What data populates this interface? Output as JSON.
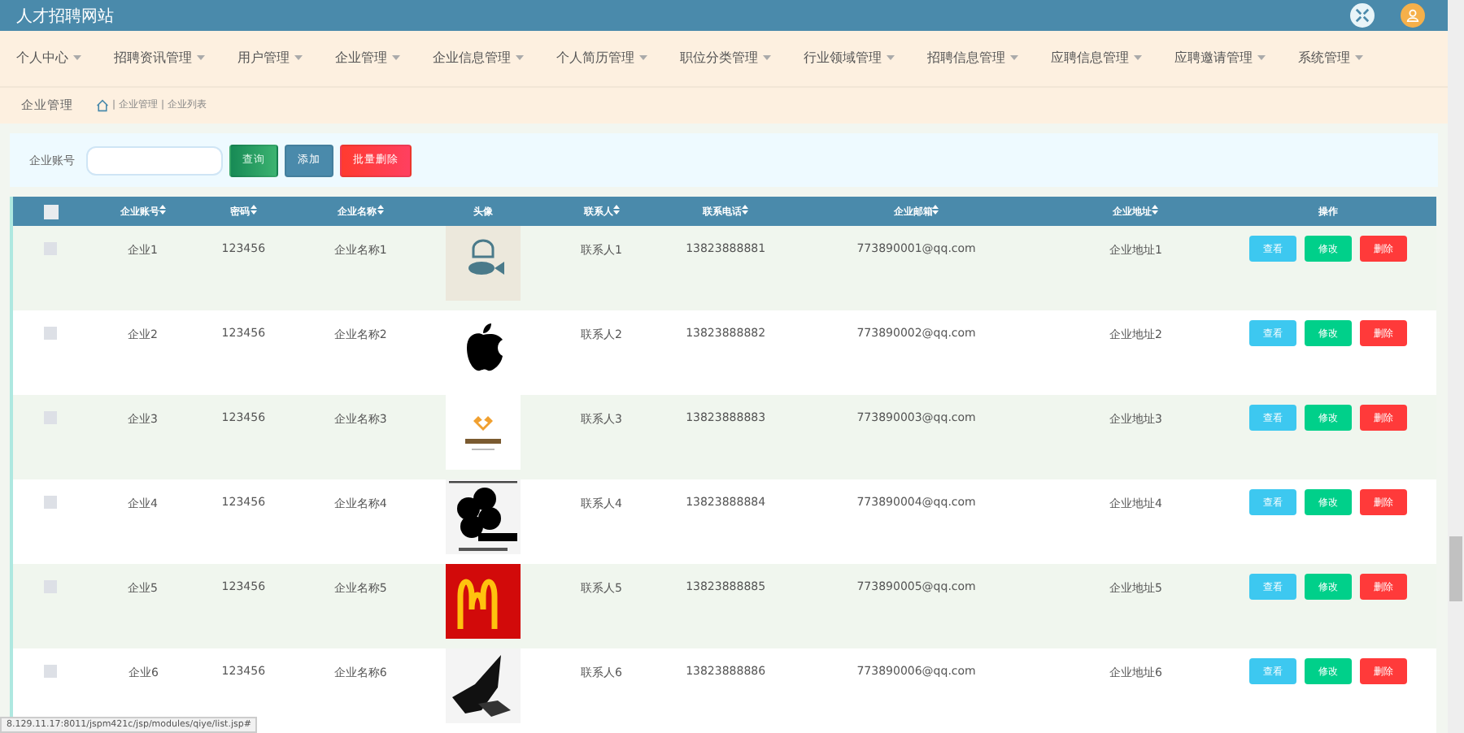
{
  "header": {
    "title": "人才招聘网站"
  },
  "nav": [
    {
      "label": "个人中心"
    },
    {
      "label": "招聘资讯管理"
    },
    {
      "label": "用户管理"
    },
    {
      "label": "企业管理"
    },
    {
      "label": "企业信息管理"
    },
    {
      "label": "个人简历管理"
    },
    {
      "label": "职位分类管理"
    },
    {
      "label": "行业领域管理"
    },
    {
      "label": "招聘信息管理"
    },
    {
      "label": "应聘信息管理"
    },
    {
      "label": "应聘邀请管理"
    },
    {
      "label": "系统管理"
    }
  ],
  "breadcrumb": {
    "title": "企业管理",
    "path": [
      {
        "separator": "|",
        "label": "企业管理"
      },
      {
        "separator": "|",
        "label": "企业列表"
      }
    ]
  },
  "search": {
    "label": "企业账号",
    "buttons": [
      {
        "label": "查询",
        "kind": "search"
      },
      {
        "label": "添加",
        "kind": "add"
      },
      {
        "label": "批量删除",
        "kind": "delete"
      }
    ]
  },
  "table": {
    "all_checked": false,
    "columns": [
      {
        "label": "企业账号",
        "sortable": true
      },
      {
        "label": "密码",
        "sortable": true
      },
      {
        "label": "企业名称",
        "sortable": true
      },
      {
        "label": "头像",
        "sortable": false
      },
      {
        "label": "联系人",
        "sortable": true
      },
      {
        "label": "联系电话",
        "sortable": true
      },
      {
        "label": "企业邮箱",
        "sortable": true
      },
      {
        "label": "企业地址",
        "sortable": true
      },
      {
        "label": "操作",
        "sortable": false
      }
    ],
    "rows": [
      {
        "checked": false,
        "account": "企业1",
        "password": "123456",
        "name": "企业名称1",
        "logo": {
          "kind": "fish"
        },
        "contact": "联系人1",
        "phone": "13823888881",
        "email": "773890001@qq.com",
        "address": "企业地址1",
        "actions": [
          {
            "label": "查看",
            "kind": "view"
          },
          {
            "label": "修改",
            "kind": "edit"
          },
          {
            "label": "删除",
            "kind": "delete"
          }
        ]
      },
      {
        "checked": false,
        "account": "企业2",
        "password": "123456",
        "name": "企业名称2",
        "logo": {
          "kind": "apple"
        },
        "contact": "联系人2",
        "phone": "13823888882",
        "email": "773890002@qq.com",
        "address": "企业地址2",
        "actions": [
          {
            "label": "查看",
            "kind": "view"
          },
          {
            "label": "修改",
            "kind": "edit"
          },
          {
            "label": "删除",
            "kind": "delete"
          }
        ]
      },
      {
        "checked": false,
        "account": "企业3",
        "password": "123456",
        "name": "企业名称3",
        "logo": {
          "kind": "heart"
        },
        "contact": "联系人3",
        "phone": "13823888883",
        "email": "773890003@qq.com",
        "address": "企业地址3",
        "actions": [
          {
            "label": "查看",
            "kind": "view"
          },
          {
            "label": "修改",
            "kind": "edit"
          },
          {
            "label": "删除",
            "kind": "delete"
          }
        ]
      },
      {
        "checked": false,
        "account": "企业4",
        "password": "123456",
        "name": "企业名称4",
        "logo": {
          "kind": "clover"
        },
        "contact": "联系人4",
        "phone": "13823888884",
        "email": "773890004@qq.com",
        "address": "企业地址4",
        "actions": [
          {
            "label": "查看",
            "kind": "view"
          },
          {
            "label": "修改",
            "kind": "edit"
          },
          {
            "label": "删除",
            "kind": "delete"
          }
        ]
      },
      {
        "checked": false,
        "account": "企业5",
        "password": "123456",
        "name": "企业名称5",
        "logo": {
          "kind": "arches"
        },
        "contact": "联系人5",
        "phone": "13823888885",
        "email": "773890005@qq.com",
        "address": "企业地址5",
        "actions": [
          {
            "label": "查看",
            "kind": "view"
          },
          {
            "label": "修改",
            "kind": "edit"
          },
          {
            "label": "删除",
            "kind": "delete"
          }
        ]
      },
      {
        "checked": false,
        "account": "企业6",
        "password": "123456",
        "name": "企业名称6",
        "logo": {
          "kind": "bird"
        },
        "contact": "联系人6",
        "phone": "13823888886",
        "email": "773890006@qq.com",
        "address": "企业地址6",
        "actions": [
          {
            "label": "查看",
            "kind": "view"
          },
          {
            "label": "修改",
            "kind": "edit"
          },
          {
            "label": "删除",
            "kind": "delete"
          }
        ]
      }
    ]
  },
  "status_url": "8.129.11.17:8011/jspm421c/jsp/modules/qiye/list.jsp#"
}
